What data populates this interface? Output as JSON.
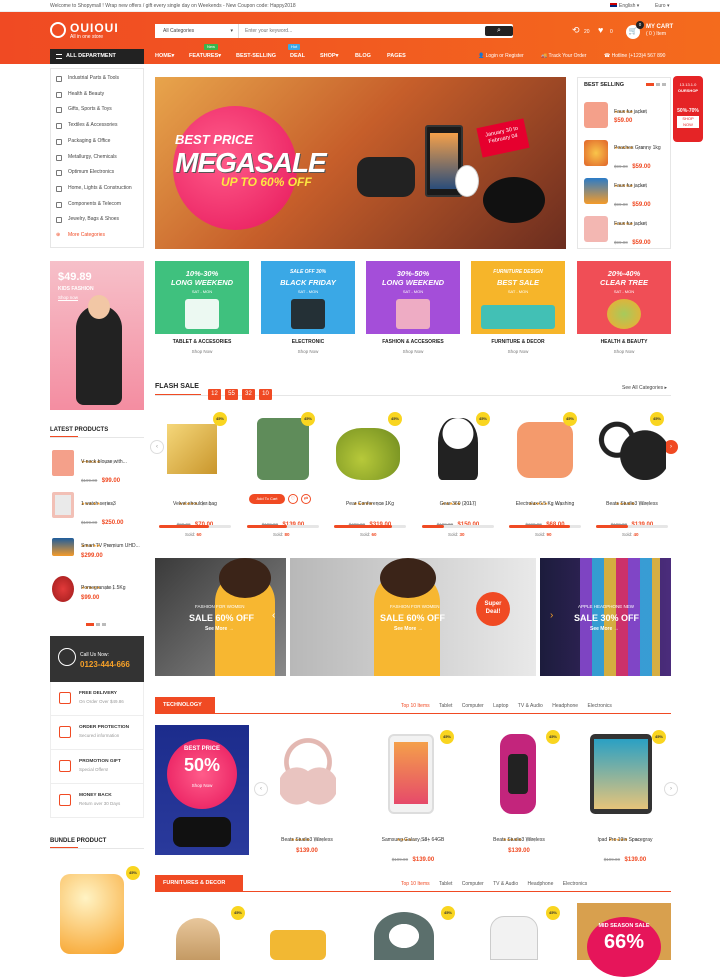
{
  "topbar": {
    "welcome": "Welcome to Shopymall ! Wrap new offers / gift every single day on Weekends - New Coupon code: Happy2018",
    "language": "English",
    "currency": "Euro"
  },
  "logo": {
    "name": "OUIOUI",
    "tagline": "All in one store"
  },
  "search": {
    "category": "All Categories",
    "placeholder": "Enter your keyword..."
  },
  "header": {
    "compare_count": "20",
    "wishlist_count": "0",
    "cart_count": "0",
    "cart_label": "MY CART",
    "cart_items": "( 0 ) Item"
  },
  "colors": {
    "brand": "#f04a23",
    "price": "#f04a23",
    "star": "#f7a128",
    "discount": "#f9d520",
    "dark": "#222222"
  },
  "nav": {
    "department": "ALL DEPARTMENT",
    "items": [
      "HOME",
      "FEATURES",
      "BEST-SELLING",
      "DEAL",
      "SHOP",
      "BLOG",
      "PAGES"
    ],
    "badges": {
      "features": "New",
      "deal": "Hot"
    },
    "login": "Login or Register",
    "track": "Track Your Order",
    "hotline": "Hotline (+123)4 567 890"
  },
  "sidebar": {
    "items": [
      "Industrial Parts & Tools",
      "Health & Beauty",
      "Gifts, Sports & Toys",
      "Textiles & Accessories",
      "Packaging & Office",
      "Metallurgy, Chemicals",
      "Optimum Electronics",
      "Home, Lights & Construction",
      "Components & Telecom",
      "Jewelry, Bags & Shoes"
    ],
    "more": "More Categories"
  },
  "hero": {
    "best_price": "BEST PRICE",
    "megasale": "MEGASALE",
    "upto": "UP TO 60% OFF",
    "date_tag": "January 30 to February 04"
  },
  "best_selling": {
    "title": "BEST SELLING",
    "items": [
      {
        "stars": "★★★★★",
        "count": "( 20 )",
        "name": "Faux fur jacket",
        "price": "$59.00",
        "old": ""
      },
      {
        "stars": "★★★★★",
        "count": "( 40 )",
        "name": "Peaches Granny 1kg",
        "price": "$59.00",
        "old": "$99.00"
      },
      {
        "stars": "★★★★★",
        "count": "( 40 )",
        "name": "Faux fur jacket",
        "price": "$59.00",
        "old": "$99.00"
      },
      {
        "stars": "★★★★★",
        "count": "( 40 )",
        "name": "Faux fur jacket",
        "price": "$59.00",
        "old": "$99.00"
      }
    ]
  },
  "promo_side": {
    "line1": "13.13.1.0",
    "line2": "OURSHOP",
    "line3": "50%-70%",
    "line4": "SHOP NOW"
  },
  "kids": {
    "price": "$49.89",
    "label": "KIDS FASHION",
    "shop": "Shop now"
  },
  "categories": [
    {
      "b1": "10%-30%",
      "b2": "LONG WEEKEND",
      "b3": "SAT - MON",
      "label": "TABLET & ACCESORIES",
      "shop": "Shop Now",
      "color": "#3fc17e"
    },
    {
      "b1": "SALE OFF 30%",
      "b2": "BLACK FRIDAY",
      "b3": "SAT - MON",
      "label": "ELECTRONIC",
      "shop": "Shop Now",
      "color": "#3aa8e6"
    },
    {
      "b1": "30%-50%",
      "b2": "LONG WEEKEND",
      "b3": "SAT - MON",
      "label": "FASHION & ACCESORIES",
      "shop": "Shop Now",
      "color": "#a44ed9"
    },
    {
      "b1": "FURNITURE DESIGN",
      "b2": "BEST SALE",
      "b3": "SAT - MON",
      "label": "FURNITURE & DECOR",
      "shop": "Shop Now",
      "color": "#f6b52a"
    },
    {
      "b1": "20%-40%",
      "b2": "CLEAR TREE",
      "b3": "SAT - MON",
      "label": "HEALTH & BEAUTY",
      "shop": "Shop Now",
      "color": "#f04e56"
    }
  ],
  "flash": {
    "title": "FLASH SALE",
    "timer": [
      "12",
      "55",
      "32",
      "10"
    ],
    "see_all": "See All Categories",
    "products": [
      {
        "disc": "45%",
        "stars": "★★★★★",
        "count": "( 20 )",
        "name": "Velvet shoulder bag",
        "old": "$99.00",
        "price": "$70.00",
        "sold_label": "Sold:",
        "sold": "60",
        "progress": 0.7
      },
      {
        "disc": "45%",
        "stars": "",
        "count": "",
        "name": "",
        "old": "$199.00",
        "price": "$139.00",
        "sold_label": "Sold:",
        "sold": "80",
        "progress": 0.55,
        "add_to_cart": "Add To Cart"
      },
      {
        "disc": "45%",
        "stars": "★★★★★",
        "count": "( 10 )",
        "name": "Pear Conference 1Kg",
        "old": "$499.00",
        "price": "$319.00",
        "sold_label": "Sold:",
        "sold": "60",
        "progress": 0.8
      },
      {
        "disc": "45%",
        "stars": "★★★★★",
        "count": "( 10 )",
        "name": "Gear 360 (2017)",
        "old": "$199.00",
        "price": "$150.00",
        "sold_label": "Sold:",
        "sold": "30",
        "progress": 0.3
      },
      {
        "disc": "45%",
        "stars": "★★★★★",
        "count": "( 40 )",
        "name": "Electrolux 6.5 Kg Washing",
        "old": "$199.00",
        "price": "$68.00",
        "sold_label": "Sold:",
        "sold": "90",
        "progress": 0.85
      },
      {
        "disc": "45%",
        "stars": "★★★★★",
        "count": "( 10 )",
        "name": "Beats Studio3 Wireless",
        "old": "$199.00",
        "price": "$139.00",
        "sold_label": "Sold:",
        "sold": "40",
        "progress": 0.45
      }
    ]
  },
  "latest": {
    "title": "LATEST PRODUCTS",
    "items": [
      {
        "stars": "★★★★★",
        "count": "( 20 )",
        "name": "V-neck blouse with...",
        "old": "$199.00",
        "price": "$99.00"
      },
      {
        "stars": "★★★★★",
        "count": "( 10 )",
        "name": "1 watch series3",
        "old": "$199.00",
        "price": "$250.00"
      },
      {
        "stars": "★★★★★",
        "count": "( 40 )",
        "name": "Smart TV Premium UHD...",
        "old": "",
        "price": "$299.00"
      },
      {
        "stars": "★★★★★",
        "count": "( 40 )",
        "name": "Pomegranate 1.5Kg",
        "old": "",
        "price": "$99.00"
      }
    ]
  },
  "banners": [
    {
      "ff": "FASHION FOR WOMEN",
      "sale": "SALE 60% OFF",
      "more": "See More"
    },
    {
      "ff": "FASHION FOR WOMEN",
      "sale": "SALE 60% OFF",
      "more": "See More",
      "badge1": "Super",
      "badge2": "Deal!"
    },
    {
      "ff": "APPLE HEADPHONE NEW",
      "sale": "SALE 30% OFF",
      "more": "See More"
    }
  ],
  "callus": {
    "label": "Call Us Now:",
    "phone": "0123-444-666"
  },
  "services": [
    {
      "t1": "FREE DELIVERY",
      "t2": "On Order Over $49.86"
    },
    {
      "t1": "ORDER PROTECTION",
      "t2": "Secured information"
    },
    {
      "t1": "PROMOTION GIFT",
      "t2": "Special Offers!"
    },
    {
      "t1": "MONEY BACK",
      "t2": "Return over 30 Days"
    }
  ],
  "bundle": {
    "title": "BUNDLE PRODUCT",
    "disc": "45%"
  },
  "technology": {
    "ribbon": "TECHNOLOGY",
    "tabs": [
      "Top 10 Items",
      "Tablet",
      "Computer",
      "Laptop",
      "TV & Audio",
      "Headphone",
      "Electronics"
    ],
    "promo": {
      "best": "BEST PRICE",
      "pct": "50%",
      "shop": "Shop Now"
    },
    "products": [
      {
        "disc": "",
        "stars": "★★★★★",
        "count": "( 10 )",
        "name": "Beats Studio3 Wireless",
        "old": "",
        "price": "$139.00"
      },
      {
        "disc": "45%",
        "stars": "★★★★☆",
        "count": "( 58 )",
        "name": "Samsung Galaxy S8+ 64GB",
        "old": "$199.00",
        "price": "$139.00"
      },
      {
        "disc": "45%",
        "stars": "★★★★★",
        "count": "( 20 )",
        "name": "Beats Studio3 Wireless",
        "old": "",
        "price": "$139.00"
      },
      {
        "disc": "45%",
        "stars": "★★★★★",
        "count": "( 58 )",
        "name": "Ipad Pro 10in Spacegray",
        "old": "$199.00",
        "price": "$139.00"
      }
    ]
  },
  "furniture": {
    "ribbon": "FURNITURES & DECOR",
    "tabs": [
      "Top 10 Items",
      "Tablet",
      "Computer",
      "TV & Audio",
      "Headphone",
      "Electronics"
    ],
    "discs": [
      "45%",
      "45%",
      "45%"
    ],
    "promo": {
      "line1": "MID SEASON SALE",
      "pct": "66%"
    }
  }
}
